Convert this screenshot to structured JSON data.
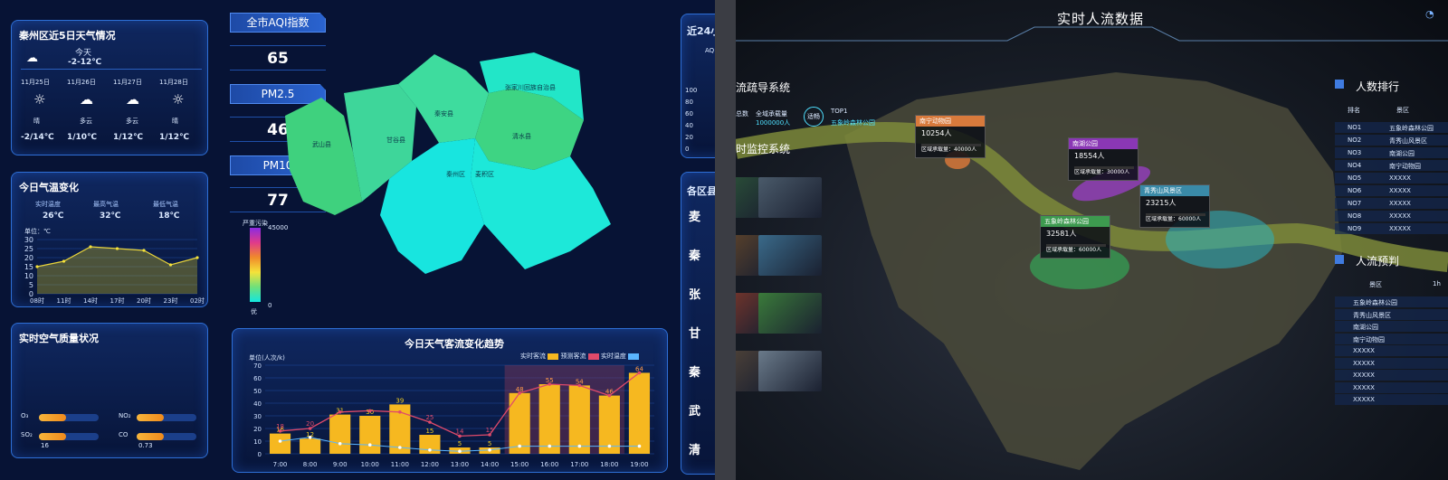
{
  "weather": {
    "title": "秦州区近5日天气情况",
    "today_label": "今天",
    "today_temp": "-2-12℃",
    "days": [
      {
        "date": "11月25日",
        "cond": "晴",
        "temp": "-2/14℃",
        "icon": "sun-icon"
      },
      {
        "date": "11月26日",
        "cond": "多云",
        "temp": "1/10℃",
        "icon": "cloud-icon"
      },
      {
        "date": "11月27日",
        "cond": "多云",
        "temp": "1/12℃",
        "icon": "cloud-icon"
      },
      {
        "date": "11月28日",
        "cond": "晴",
        "temp": "1/12℃",
        "icon": "sun-icon"
      }
    ]
  },
  "tempchange": {
    "title": "今日气温变化",
    "cur_label": "实时温度",
    "cur": "26℃",
    "max_label": "最高气温",
    "max": "32℃",
    "min_label": "最低气温",
    "min": "18℃",
    "unit": "单位：℃",
    "yticks": [
      "30",
      "25",
      "20",
      "15",
      "10",
      "5",
      "0"
    ],
    "xticks": [
      "08时",
      "11时",
      "14时",
      "17时",
      "20时",
      "23时",
      "02时"
    ]
  },
  "air": {
    "title": "实时空气质量状况",
    "items": [
      {
        "label": "O₃",
        "value": ""
      },
      {
        "label": "NO₂",
        "value": ""
      },
      {
        "label": "SO₂",
        "value": "16"
      },
      {
        "label": "CO",
        "value": "0.73"
      }
    ]
  },
  "aqi": {
    "title": "全市AQI指数",
    "aqi": "65",
    "pm25_label": "PM2.5",
    "pm25": "46",
    "pm10_label": "PM10",
    "pm10": "77",
    "scale_top": "严重污染",
    "scale_max": "45000",
    "scale_min": "0",
    "scale_bottom": "优"
  },
  "map": {
    "labels": [
      "张家川回族自治县",
      "清水县",
      "秦安县",
      "甘谷县",
      "武山县",
      "麦积区",
      "秦州区"
    ]
  },
  "flow": {
    "title": "今日天气客流变化趋势",
    "unit": "单位(人次/k)",
    "legend": [
      "实时客流",
      "预测客流",
      "实时温度"
    ],
    "yticks": [
      "70",
      "60",
      "50",
      "40",
      "30",
      "20",
      "10",
      "0"
    ]
  },
  "side": {
    "t1": "近24小",
    "t1b": "AQ",
    "yt": [
      "100",
      "80",
      "60",
      "40",
      "20",
      "0"
    ],
    "t2": "各区县",
    "items": [
      "麦",
      "秦",
      "张",
      "甘",
      "秦",
      "武",
      "清"
    ]
  },
  "chart_data": {
    "type": "bar",
    "title": "今日天气客流变化趋势",
    "ylabel": "单位(人次/k)",
    "ylim": [
      0,
      70
    ],
    "categories": [
      "7:00",
      "8:00",
      "9:00",
      "10:00",
      "11:00",
      "12:00",
      "13:00",
      "14:00",
      "15:00",
      "16:00",
      "17:00",
      "18:00",
      "19:00"
    ],
    "series": [
      {
        "name": "实时客流",
        "values": [
          16,
          12,
          31,
          30,
          39,
          15,
          5,
          5,
          48,
          55,
          54,
          46,
          64
        ]
      },
      {
        "name": "预测客流",
        "values": [
          18,
          20,
          33,
          34,
          33,
          25,
          14,
          15,
          48,
          55,
          54,
          46,
          64
        ]
      },
      {
        "name": "实时温度",
        "values": [
          10,
          13,
          8,
          7,
          5,
          3,
          2,
          3,
          6,
          6,
          6,
          6,
          6
        ]
      }
    ],
    "bar_labels": [
      "16",
      "12",
      "31",
      "30",
      "39",
      "15",
      "5",
      "5",
      "48",
      "55",
      "54",
      "46",
      "64"
    ],
    "pred_labels": [
      "18",
      "20",
      "",
      "",
      "",
      "25",
      "14",
      "15",
      "",
      "",
      "",
      "",
      ""
    ]
  },
  "right": {
    "title": "实时人流数据",
    "left_t1": "流疏导系统",
    "stat1": "总数",
    "stat2": "全域承载量",
    "stat2v": "1000000人",
    "badge": "适畅",
    "top": "TOP1",
    "top_name": "五象岭森林公园",
    "left_t2": "时监控系统",
    "rank_title": "人数排行",
    "rank_cols": [
      "排名",
      "景区"
    ],
    "rank": [
      [
        "NO1",
        "五象岭森林公园"
      ],
      [
        "NO2",
        "青秀山风景区"
      ],
      [
        "NO3",
        "南湖公园"
      ],
      [
        "NO4",
        "南宁动物园"
      ],
      [
        "NO5",
        "XXXXX"
      ],
      [
        "NO6",
        "XXXXX"
      ],
      [
        "NO7",
        "XXXXX"
      ],
      [
        "NO8",
        "XXXXX"
      ],
      [
        "NO9",
        "XXXXX"
      ]
    ],
    "pred_title": "人流预判",
    "pred_col": "景区",
    "pred_col2": "1h",
    "pred": [
      "五象岭森林公园",
      "青秀山风景区",
      "南湖公园",
      "南宁动物园",
      "XXXXX",
      "XXXXX",
      "XXXXX",
      "XXXXX",
      "XXXXX"
    ],
    "cards": [
      {
        "name": "南宁动物园",
        "count": "10254人",
        "cap": "区域承载量：40000人",
        "color": "#d87a3c"
      },
      {
        "name": "南湖公园",
        "count": "18554人",
        "cap": "区域承载量：30000人",
        "color": "#8a37b5"
      },
      {
        "name": "青秀山风景区",
        "count": "23215人",
        "cap": "区域承载量：60000人",
        "color": "#3a8aa8"
      },
      {
        "name": "五象岭森林公园",
        "count": "32581人",
        "cap": "区域承载量：60000人",
        "color": "#3d9a4f"
      }
    ]
  }
}
